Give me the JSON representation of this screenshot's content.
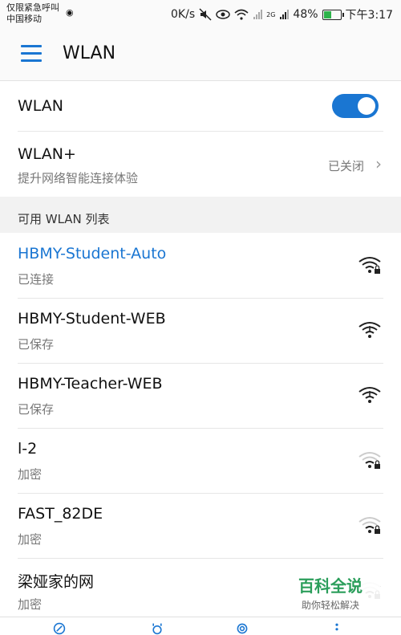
{
  "status_bar": {
    "emergency": "仅限紧急呼叫",
    "carrier": "中国移动",
    "speed": "0K/s",
    "network": "2G",
    "battery": "48%",
    "battery_level": 0.48,
    "time": "下午3:17"
  },
  "app_bar": {
    "title": "WLAN"
  },
  "wlan_toggle": {
    "label": "WLAN",
    "on": true
  },
  "wlan_plus": {
    "label": "WLAN+",
    "subtitle": "提升网络智能连接体验",
    "state": "已关闭"
  },
  "section_title": "可用 WLAN 列表",
  "networks": [
    {
      "name": "HBMY-Student-Auto",
      "status": "已连接",
      "locked": true,
      "connected": true
    },
    {
      "name": "HBMY-Student-WEB",
      "status": "已保存",
      "locked": false,
      "connected": false
    },
    {
      "name": "HBMY-Teacher-WEB",
      "status": "已保存",
      "locked": false,
      "connected": false
    },
    {
      "name": "l-2",
      "status": "加密",
      "locked": true,
      "connected": false
    },
    {
      "name": "FAST_82DE",
      "status": "加密",
      "locked": true,
      "connected": false
    },
    {
      "name": "梁娅家的网",
      "status": "加密",
      "locked": true,
      "connected": false
    }
  ],
  "watermark": {
    "title": "百科全说",
    "subtitle": "助你轻松解决"
  },
  "colors": {
    "accent": "#1a76d2",
    "watermark": "#2b9e5b"
  }
}
